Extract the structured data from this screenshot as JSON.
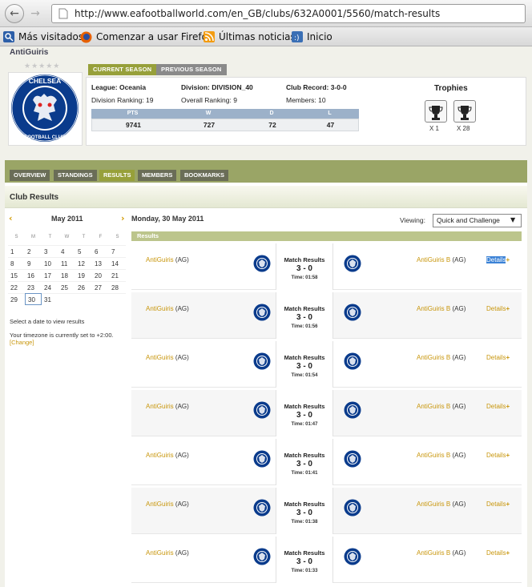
{
  "browser": {
    "back_icon": "arrow-left-icon",
    "forward_icon": "arrow-right-icon",
    "url": "http://www.eafootballworld.com/en_GB/clubs/632A0001/5560/match-results",
    "bookmarks": [
      {
        "label": "Más visitados",
        "icon": "search-icon"
      },
      {
        "label": "Comenzar a usar Firefox",
        "icon": "firefox-icon"
      },
      {
        "label": "Últimas noticias",
        "icon": "rss-icon"
      },
      {
        "label": "Inicio",
        "icon": "home-icon"
      }
    ]
  },
  "club": {
    "name": "AntiGuiris",
    "stars": "★★★★★",
    "season_tabs": [
      "CURRENT SEASON",
      "PREVIOUS SEASON"
    ],
    "league_label": "League:",
    "league": "Oceania",
    "division_label": "Division:",
    "division": "DIVISION_40",
    "record_label": "Club Record:",
    "record": "3-0-0",
    "division_ranking_label": "Division Ranking:",
    "division_ranking": "19",
    "overall_ranking_label": "Overall Ranking:",
    "overall_ranking": "9",
    "members_label": "Members:",
    "members": "10",
    "stats_headers": [
      "PTS",
      "W",
      "D",
      "L"
    ],
    "stats_values": [
      "9741",
      "727",
      "72",
      "47"
    ],
    "trophies_title": "Trophies",
    "trophies": [
      {
        "count": "X 1"
      },
      {
        "count": "X 28"
      }
    ]
  },
  "nav_tabs": [
    "OVERVIEW",
    "STANDINGS",
    "RESULTS",
    "MEMBERS",
    "BOOKMARKS"
  ],
  "active_tab": "RESULTS",
  "section_title": "Club Results",
  "calendar": {
    "month": "May 2011",
    "prev_icon": "chevron-left-icon",
    "next_icon": "chevron-right-icon",
    "day_headers": [
      "S",
      "M",
      "T",
      "W",
      "T",
      "F",
      "S"
    ],
    "weeks": [
      [
        "1",
        "2",
        "3",
        "4",
        "5",
        "6",
        "7"
      ],
      [
        "8",
        "9",
        "10",
        "11",
        "12",
        "13",
        "14"
      ],
      [
        "15",
        "16",
        "17",
        "18",
        "19",
        "20",
        "21"
      ],
      [
        "22",
        "23",
        "24",
        "25",
        "26",
        "27",
        "28"
      ],
      [
        "29",
        "30",
        "31",
        "",
        "",
        "",
        ""
      ]
    ],
    "selected": "30",
    "note": "Select a date to view results",
    "timezone_note": "Your timezone is currently set to +2:00.",
    "change_link": "[Change]"
  },
  "results": {
    "day_title": "Monday, 30 May 2011",
    "viewing_label": "Viewing:",
    "viewing_value": "Quick and Challenge",
    "bar_label": "Results",
    "match_label": "Match Results",
    "details_label": "Details",
    "matches": [
      {
        "home": "AntiGuiris",
        "home_tag": "(AG)",
        "away": "AntiGuiris B",
        "away_tag": "(AG)",
        "score": "3 - 0",
        "time": "Time: 01:58"
      },
      {
        "home": "AntiGuiris",
        "home_tag": "(AG)",
        "away": "AntiGuiris B",
        "away_tag": "(AG)",
        "score": "3 - 0",
        "time": "Time: 01:56"
      },
      {
        "home": "AntiGuiris",
        "home_tag": "(AG)",
        "away": "AntiGuiris B",
        "away_tag": "(AG)",
        "score": "3 - 0",
        "time": "Time: 01:54"
      },
      {
        "home": "AntiGuiris",
        "home_tag": "(AG)",
        "away": "AntiGuiris B",
        "away_tag": "(AG)",
        "score": "3 - 0",
        "time": "Time: 01:47"
      },
      {
        "home": "AntiGuiris",
        "home_tag": "(AG)",
        "away": "AntiGuiris B",
        "away_tag": "(AG)",
        "score": "3 - 0",
        "time": "Time: 01:41"
      },
      {
        "home": "AntiGuiris",
        "home_tag": "(AG)",
        "away": "AntiGuiris B",
        "away_tag": "(AG)",
        "score": "3 - 0",
        "time": "Time: 01:38"
      },
      {
        "home": "AntiGuiris",
        "home_tag": "(AG)",
        "away": "AntiGuiris B",
        "away_tag": "(AG)",
        "score": "3 - 0",
        "time": "Time: 01:33"
      }
    ]
  },
  "colors": {
    "accent": "#c8960c",
    "nav_green": "#9aa566",
    "active_tab": "#97a03a",
    "stats_header": "#9cb1c9",
    "chelsea_blue": "#0a3b8c"
  }
}
